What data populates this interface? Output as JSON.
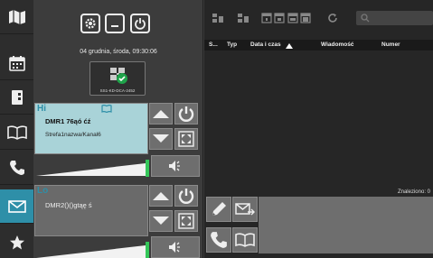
{
  "header": {
    "datetime": "04 grudnia, środa, 09:30:06"
  },
  "device": {
    "label": "SS1-KD-DCA-2452",
    "status": "connected"
  },
  "channels": [
    {
      "tag": "Hi",
      "name": "DMR1 76ąó ćź",
      "zone": "Strefa1nazwa/Kanal6",
      "selected": true,
      "volume": 1.0
    },
    {
      "tag": "Lo",
      "name": "DMR2()()gtąę ś",
      "zone": "",
      "selected": false,
      "volume": 1.0
    }
  ],
  "table": {
    "columns": [
      "S...",
      "Typ",
      "Data i czas",
      "Wiadomość",
      "Numer"
    ],
    "sort_column": "Data i czas",
    "rows": []
  },
  "status": {
    "found": "Znaleziono: 0"
  },
  "colors": {
    "accent": "#2e8fa8",
    "selected_channel": "#a9d3d8",
    "volume_indicator": "#34c759"
  },
  "icons": {
    "nav": [
      "map-icon",
      "calendar-icon",
      "phonebook-icon",
      "book-icon",
      "phone-icon",
      "envelope-icon",
      "star-icon"
    ]
  }
}
